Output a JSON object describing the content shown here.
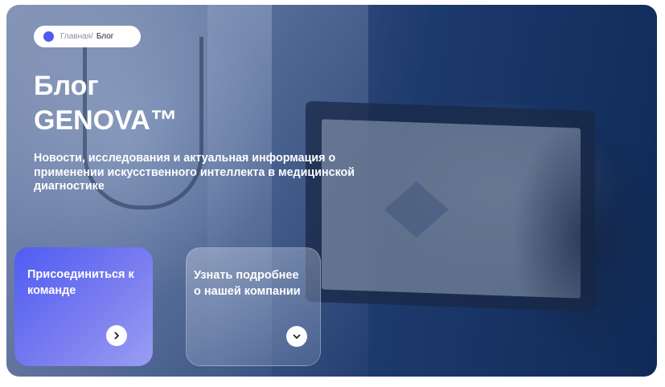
{
  "breadcrumb": {
    "home": "Главная/",
    "current": "Блог"
  },
  "hero": {
    "title_line1": "Блог",
    "title_line2": "GENOVA™",
    "subtitle": "Новости, исследования и актуальная информация о применении искусственного интеллекта в медицинской диагностике"
  },
  "cards": {
    "join": {
      "label": "Присоединиться к команде",
      "icon": "chevron-right-icon"
    },
    "about": {
      "label": "Узнать подробнее о нашей компании",
      "icon": "chevron-down-icon"
    }
  },
  "colors": {
    "accent": "#4f5bea",
    "overlay": "#1d3a6c"
  }
}
